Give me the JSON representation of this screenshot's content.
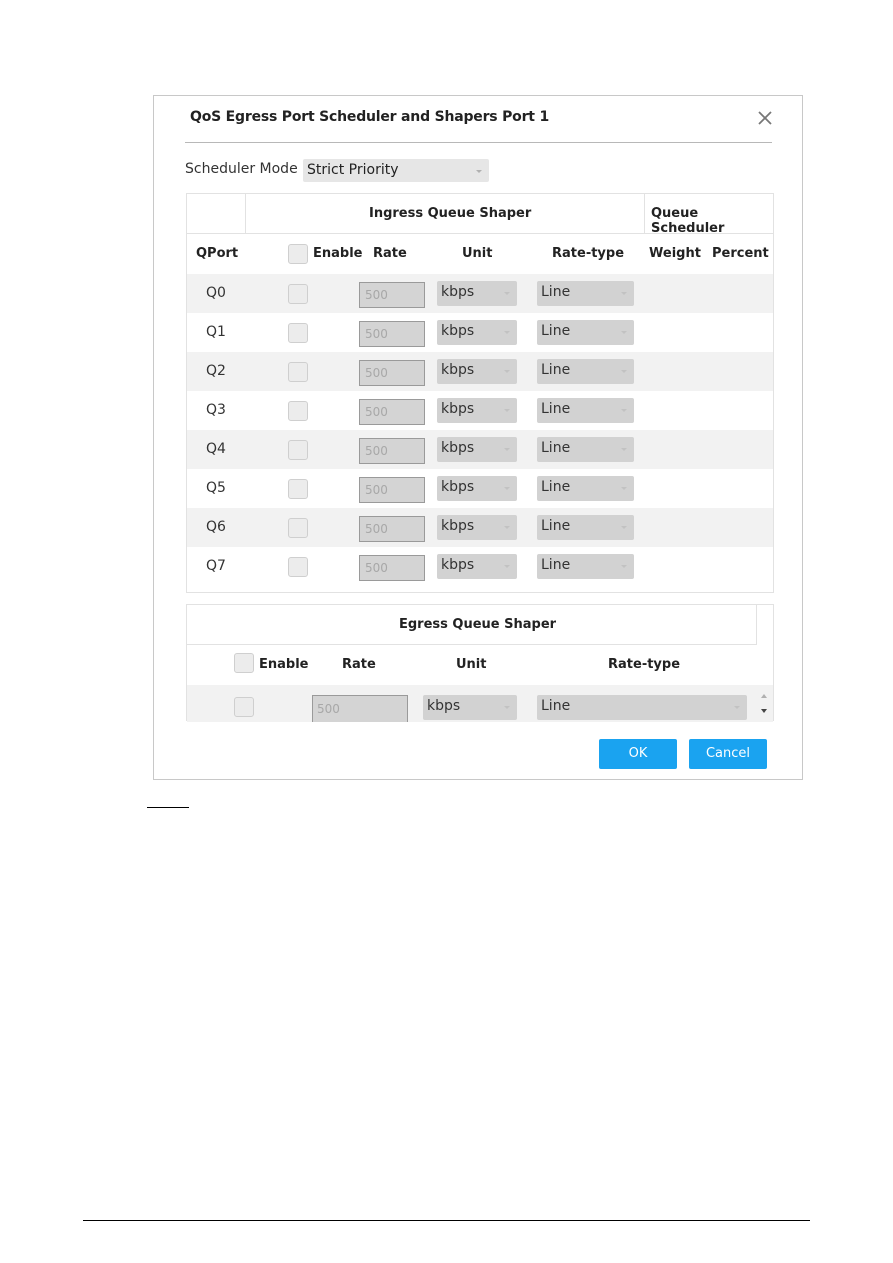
{
  "dialog": {
    "title": "QoS Egress Port Scheduler and Shapers Port 1",
    "close_icon": "close-icon"
  },
  "scheduler": {
    "label": "Scheduler Mode",
    "selected": "Strict Priority"
  },
  "ingress": {
    "group_title": "Ingress Queue Shaper",
    "scheduler_group_title": "Queue Scheduler",
    "columns": {
      "qport": "QPort",
      "enable": "Enable",
      "rate": "Rate",
      "unit": "Unit",
      "rate_type": "Rate-type",
      "weight": "Weight",
      "percent": "Percent"
    },
    "rows": [
      {
        "queue": "Q0",
        "rate": "500",
        "unit": "kbps",
        "rate_type": "Line"
      },
      {
        "queue": "Q1",
        "rate": "500",
        "unit": "kbps",
        "rate_type": "Line"
      },
      {
        "queue": "Q2",
        "rate": "500",
        "unit": "kbps",
        "rate_type": "Line"
      },
      {
        "queue": "Q3",
        "rate": "500",
        "unit": "kbps",
        "rate_type": "Line"
      },
      {
        "queue": "Q4",
        "rate": "500",
        "unit": "kbps",
        "rate_type": "Line"
      },
      {
        "queue": "Q5",
        "rate": "500",
        "unit": "kbps",
        "rate_type": "Line"
      },
      {
        "queue": "Q6",
        "rate": "500",
        "unit": "kbps",
        "rate_type": "Line"
      },
      {
        "queue": "Q7",
        "rate": "500",
        "unit": "kbps",
        "rate_type": "Line"
      }
    ]
  },
  "egress": {
    "group_title": "Egress Queue Shaper",
    "columns": {
      "enable": "Enable",
      "rate": "Rate",
      "unit": "Unit",
      "rate_type": "Rate-type"
    },
    "row": {
      "rate": "500",
      "unit": "kbps",
      "rate_type": "Line"
    }
  },
  "buttons": {
    "ok": "OK",
    "cancel": "Cancel"
  },
  "colors": {
    "accent": "#1aa3f0",
    "row_alt": "#f2f2f2",
    "disabled_field": "#d2d2d2"
  }
}
